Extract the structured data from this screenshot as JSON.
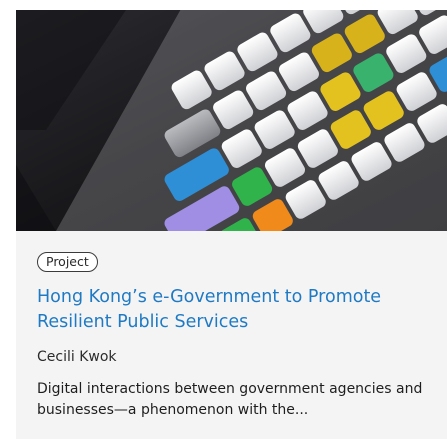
{
  "card": {
    "image_alt": "Colorful keyboard keycaps",
    "tag": "Project",
    "title": "Hong Kong’s e-Government to Promote Resilient Public Services",
    "author": "Cecili Kwok",
    "excerpt": "Digital interactions between government agencies and businesses—a phenomenon with the...",
    "colors": {
      "title": "#1f7ac4",
      "background": "#f4f4f5"
    }
  }
}
